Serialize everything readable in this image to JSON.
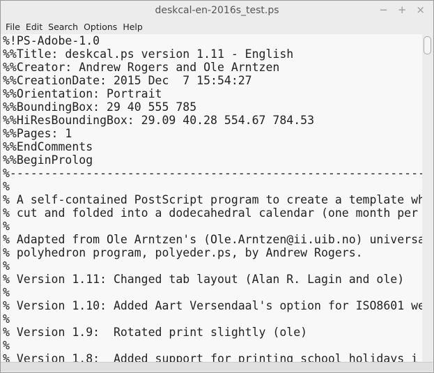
{
  "window": {
    "title": "deskcal-en-2016s_test.ps",
    "minimize": "−",
    "maximize": "+",
    "close": "×"
  },
  "menu": [
    "File",
    "Edit",
    "Search",
    "Options",
    "Help"
  ],
  "lines": [
    "%!PS-Adobe-1.0",
    "%%Title: deskcal.ps version 1.11 - English",
    "%%Creator: Andrew Rogers and Ole Arntzen",
    "%%CreationDate: 2015 Dec  7 15:54:27",
    "%%Orientation: Portrait",
    "%%BoundingBox: 29 40 555 785",
    "%%HiResBoundingBox: 29.09 40.28 554.67 784.53",
    "%%Pages: 1",
    "%%EndComments",
    "%%BeginProlog",
    "%-------------------------------------------------------------",
    "%",
    "% A self-contained PostScript program to create a template wh",
    "% cut and folded into a dodecahedral calendar (one month per",
    "%",
    "% Adapted from Ole Arntzen's (Ole.Arntzen@ii.uib.no) universa",
    "% polyhedron program, polyeder.ps, by Andrew Rogers.",
    "%",
    "% Version 1.11: Changed tab layout (Alan R. Lagin and ole)",
    "%",
    "% Version 1.10: Added Aart Versendaal's option for ISO8601 we",
    "%",
    "% Version 1.9:  Rotated print slightly (ole)",
    "%",
    "% Version 1.8:  Added support for printing school holidays i"
  ]
}
